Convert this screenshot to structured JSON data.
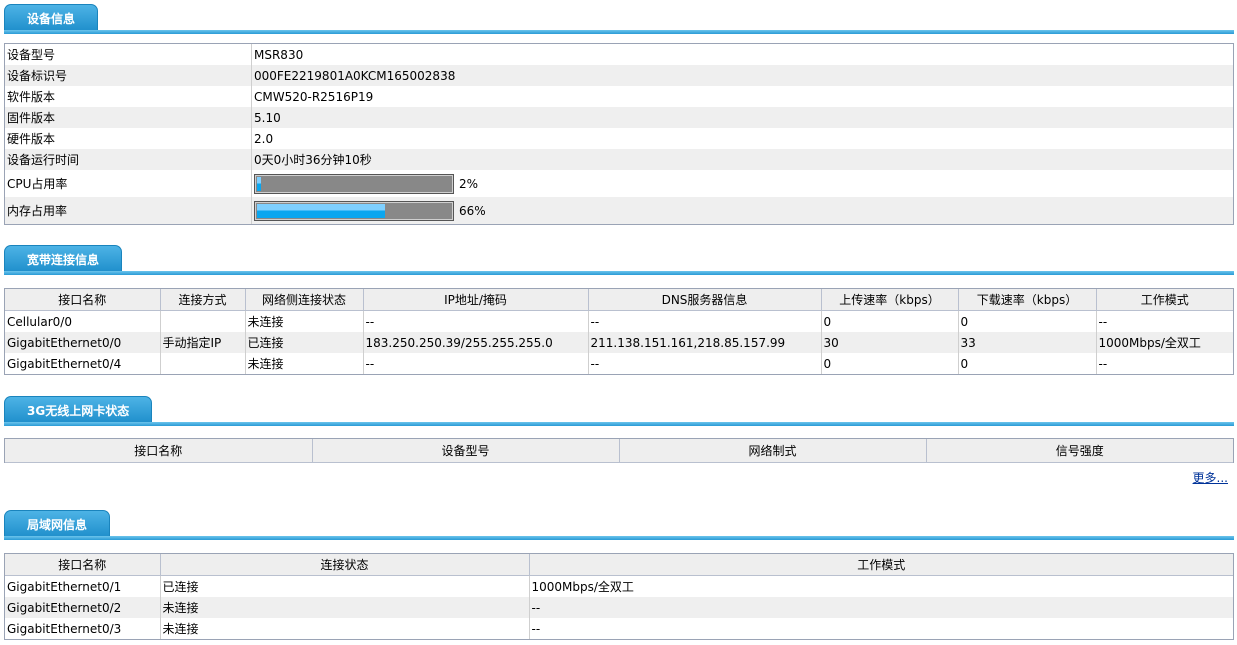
{
  "device": {
    "title": "设备信息",
    "rows": [
      {
        "label": "设备型号",
        "value": "MSR830"
      },
      {
        "label": "设备标识号",
        "value": "000FE2219801A0KCM165002838"
      },
      {
        "label": "软件版本",
        "value": "CMW520-R2516P19"
      },
      {
        "label": "固件版本",
        "value": "5.10"
      },
      {
        "label": "硬件版本",
        "value": "2.0"
      },
      {
        "label": "设备运行时间",
        "value": "0天0小时36分钟10秒"
      }
    ],
    "cpu": {
      "label": "CPU占用率",
      "percent_text": "2%",
      "percent": 2
    },
    "mem": {
      "label": "内存占用率",
      "percent_text": "66%",
      "percent": 66
    }
  },
  "broadband": {
    "title": "宽带连接信息",
    "headers": [
      "接口名称",
      "连接方式",
      "网络侧连接状态",
      "IP地址/掩码",
      "DNS服务器信息",
      "上传速率（kbps）",
      "下载速率（kbps）",
      "工作模式"
    ],
    "rows": [
      [
        "Cellular0/0",
        "",
        "未连接",
        "--",
        "--",
        "0",
        "0",
        "--"
      ],
      [
        "GigabitEthernet0/0",
        "手动指定IP",
        "已连接",
        "183.250.250.39/255.255.255.0",
        "211.138.151.161,218.85.157.99",
        "30",
        "33",
        "1000Mbps/全双工"
      ],
      [
        "GigabitEthernet0/4",
        "",
        "未连接",
        "--",
        "--",
        "0",
        "0",
        "--"
      ]
    ]
  },
  "wireless3g": {
    "title": "3G无线上网卡状态",
    "headers": [
      "接口名称",
      "设备型号",
      "网络制式",
      "信号强度"
    ],
    "more_link": "更多..."
  },
  "lan": {
    "title": "局域网信息",
    "headers": [
      "接口名称",
      "连接状态",
      "工作模式"
    ],
    "rows": [
      [
        "GigabitEthernet0/1",
        "已连接",
        "1000Mbps/全双工"
      ],
      [
        "GigabitEthernet0/2",
        "未连接",
        "--"
      ],
      [
        "GigabitEthernet0/3",
        "未连接",
        "--"
      ]
    ]
  },
  "colors": {
    "accent": "#2a9bd6",
    "bar_fill": "#0aa6ef",
    "bar_bg": "#888888"
  }
}
